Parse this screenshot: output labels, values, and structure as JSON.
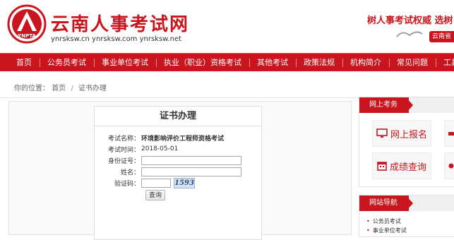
{
  "header": {
    "site_title": "云南人事考试网",
    "domains": "ynrsksw.cn ynrsksw.com ynrsksw.net",
    "logo_text": "YNPTA",
    "slogan": "树人事考试权威 选树",
    "stamp_text": "云南省"
  },
  "nav": {
    "items": [
      {
        "label": "首页"
      },
      {
        "label": "公务员考试"
      },
      {
        "label": "事业单位考试"
      },
      {
        "label": "执业（职业）资格考试"
      },
      {
        "label": "其他考试"
      },
      {
        "label": "政策法规"
      },
      {
        "label": "机构简介"
      },
      {
        "label": "常见问题"
      },
      {
        "label": "工具下载"
      }
    ]
  },
  "breadcrumb": {
    "prefix": "你的位置：",
    "home": "首页",
    "separator": "/",
    "current": "证书办理"
  },
  "cert": {
    "title": "证书办理",
    "exam_name_label": "考试名称：",
    "exam_name_value": "环境影响评价工程师资格考试",
    "exam_time_label": "考试时间：",
    "exam_time_value": "2018-05-01",
    "id_label": "身份证号：",
    "id_value": "",
    "name_label": "姓名：",
    "name_value": "",
    "captcha_label": "验证码：",
    "captcha_value": "",
    "captcha_code": "1593",
    "query_button": "查询"
  },
  "sidebar": {
    "online_exam": {
      "title": "网上考务",
      "tiles": [
        {
          "label": "网上报名",
          "icon": "monitor-icon"
        },
        {
          "label": "成绩查询",
          "icon": "calendar-icon"
        }
      ]
    },
    "site_nav": {
      "title": "网站导航",
      "items": [
        {
          "label": "公务员考试"
        },
        {
          "label": "事业单位考试"
        }
      ]
    }
  },
  "colors": {
    "brand_red": "#c8151e",
    "captcha_bg": "#d6e3f0"
  }
}
